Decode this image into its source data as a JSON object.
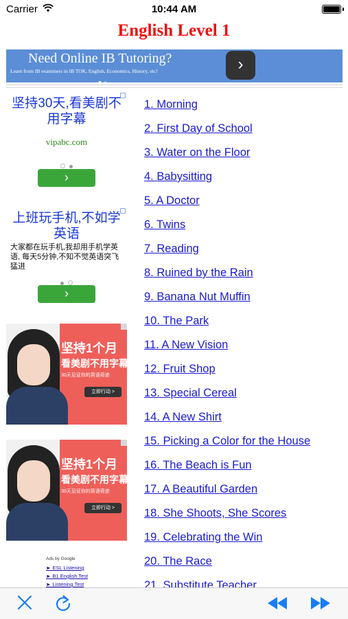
{
  "status_bar": {
    "carrier": "Carrier",
    "time": "10:44 AM"
  },
  "page": {
    "title": "English Level 1"
  },
  "top_banner": {
    "headline": "Need Online IB Tutoring?",
    "subline": "Learn from IB examiners in IB TOK, English, Economics, History, etc!"
  },
  "side_ads": {
    "ad1": {
      "headline": "坚持30天,看美剧不用字幕",
      "url": "vipabc.com"
    },
    "ad2": {
      "headline": "上班玩手机,不如学英语",
      "body": "大家都在玩手机,我却用手机学英语, 每天5分钟,不知不觉英语突飞猛进"
    },
    "image_ad": {
      "line1": "坚持1个月",
      "line2": "看美剧不用字幕",
      "line3": "30天见证你的英语奇迹",
      "cta": "立即行动 >"
    },
    "google": {
      "header": "Ads by Google",
      "links": [
        "► ESL Listening",
        "► B1 English Test",
        "► Listening Test"
      ]
    }
  },
  "stories": [
    "1. Morning",
    "2. First Day of School",
    "3. Water on the Floor",
    "4. Babysitting",
    "5. A Doctor",
    "6. Twins",
    "7. Reading",
    "8. Ruined by the Rain",
    "9. Banana Nut Muffin",
    "10. The Park",
    "11. A New Vision",
    "12. Fruit Shop",
    "13. Special Cereal",
    "14. A New Shirt",
    "15. Picking a Color for the House",
    "16. The Beach is Fun",
    "17. A Beautiful Garden",
    "18. She Shoots, She Scores",
    "19. Celebrating the Win",
    "20. The Race",
    "21. Substitute Teacher"
  ],
  "toolbar": {
    "icons": [
      "close-icon",
      "refresh-icon",
      "rewind-icon",
      "fast-forward-icon"
    ]
  },
  "colors": {
    "title": "#ee1111",
    "link": "#1a1ad1",
    "toolbar_icon": "#1a7cf4",
    "banner": "#5b8ed6"
  }
}
